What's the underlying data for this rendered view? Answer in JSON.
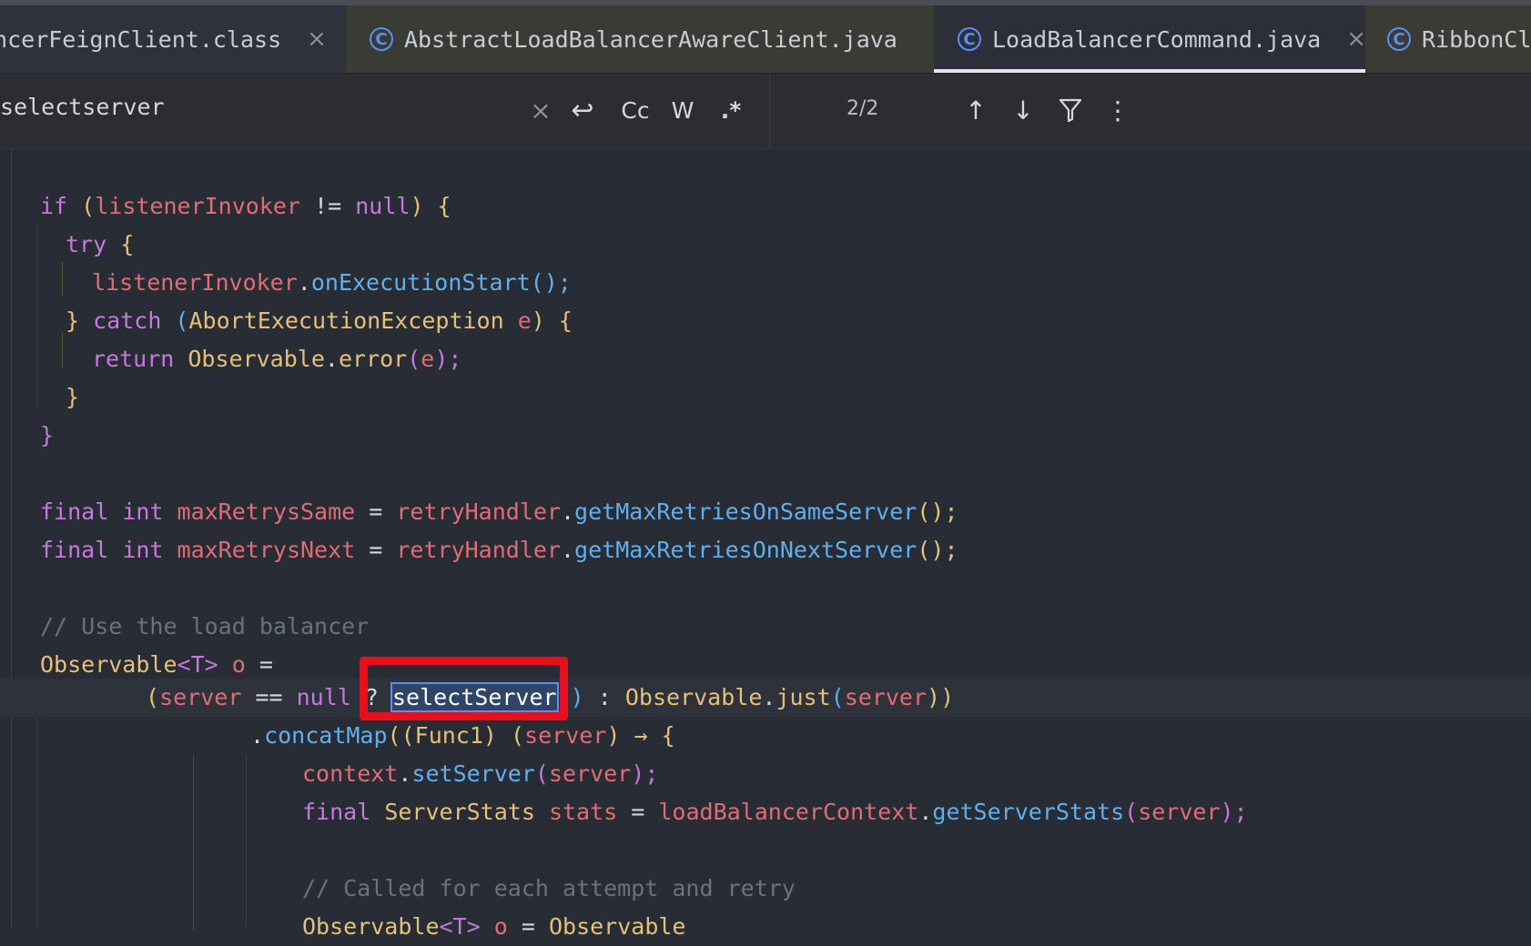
{
  "tabs": [
    {
      "label": "ancerFeignClient.class",
      "has_icon": false,
      "closable": true
    },
    {
      "label": "AbstractLoadBalancerAwareClient.java",
      "has_icon": true,
      "closable": false
    },
    {
      "label": "LoadBalancerCommand.java",
      "has_icon": true,
      "closable": true,
      "active": true
    },
    {
      "label": "RibbonCl",
      "has_icon": true,
      "closable": false
    }
  ],
  "find": {
    "query": "selectserver",
    "clear_icon": "×",
    "newline_icon": "↩",
    "match_case": "Cc",
    "words": "W",
    "regex": ".*",
    "match_count": "2/2",
    "prev_icon": "↑",
    "next_icon": "↓",
    "filter_icon": "filter",
    "more_icon": "⋮"
  },
  "code": {
    "l1": [
      "if",
      " (",
      "listenerInvoker",
      " != ",
      "null",
      ") {"
    ],
    "l2": [
      "try",
      " {"
    ],
    "l3": [
      "listenerInvoker",
      ".",
      "onExecutionStart",
      "();"
    ],
    "l4": [
      "}",
      " catch ",
      "(",
      "AbortExecutionException",
      " ",
      "e",
      ") {"
    ],
    "l5": [
      "return ",
      "Observable",
      ".",
      "error",
      "(",
      "e",
      ");"
    ],
    "l6": [
      "}"
    ],
    "l7": [
      "}"
    ],
    "l8": [
      "final ",
      "int ",
      "maxRetrysSame",
      " = ",
      "retryHandler",
      ".",
      "getMaxRetriesOnSameServer",
      "();"
    ],
    "l9": [
      "final ",
      "int ",
      "maxRetrysNext",
      " = ",
      "retryHandler",
      ".",
      "getMaxRetriesOnNextServer",
      "();"
    ],
    "l10": [
      "// Use the load balancer"
    ],
    "l11": [
      "Observable",
      "<",
      "T",
      "> ",
      "o",
      " ="
    ],
    "l12": [
      "(",
      "server",
      " == ",
      "null",
      " ? ",
      "selectServer",
      "()",
      " : ",
      "Observable",
      ".",
      "just",
      "(",
      "server",
      "))"
    ],
    "l13": [
      ".",
      "concatMap",
      "((",
      "Func1",
      ") (",
      "server",
      ") → {"
    ],
    "l14": [
      "context",
      ".",
      "setServer",
      "(",
      "server",
      ");"
    ],
    "l15": [
      "final ",
      "ServerStats ",
      "stats",
      " = ",
      "loadBalancerContext",
      ".",
      "getServerStats",
      "(",
      "server",
      ");"
    ],
    "l16": [
      "// Called for each attempt and retry"
    ],
    "l17": [
      "Observable",
      "<",
      "T",
      "> ",
      "o",
      " = ",
      "Observable"
    ]
  }
}
